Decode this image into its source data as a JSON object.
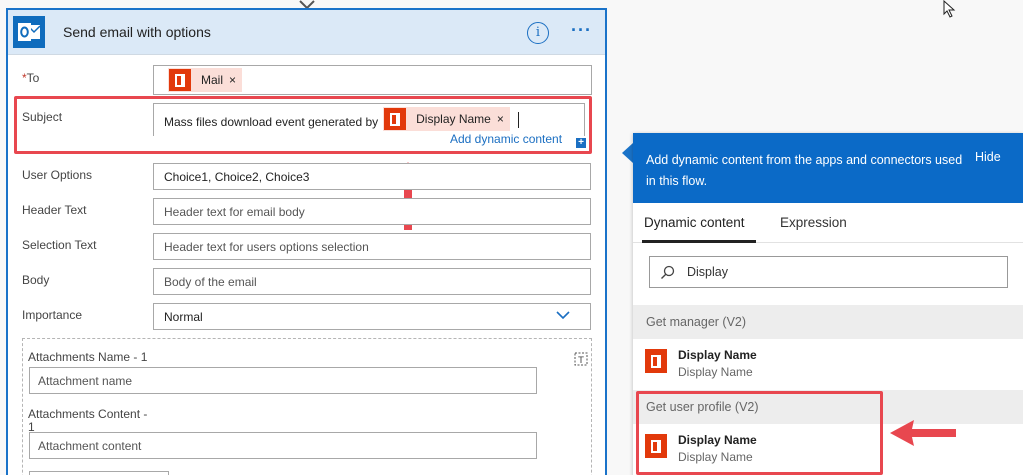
{
  "card": {
    "title": "Send email with options",
    "info_glyph": "i",
    "more_glyph": "···",
    "icons": {
      "app": "outlook-icon",
      "info": "info-icon",
      "more": "more-icon"
    }
  },
  "fields": {
    "to": {
      "label": "To",
      "required_mark": "*",
      "token": "Mail",
      "token_remove": "×"
    },
    "subject": {
      "label": "Subject",
      "text": "Mass files download event generated by",
      "token": "Display Name",
      "token_remove": "×"
    },
    "add_dynamic": {
      "label": "Add dynamic content",
      "plus": "+"
    },
    "user_options": {
      "label": "User Options",
      "value": "Choice1, Choice2, Choice3"
    },
    "header_text": {
      "label": "Header Text",
      "placeholder": "Header text for email body"
    },
    "selection_text": {
      "label": "Selection Text",
      "placeholder": "Header text for users options selection"
    },
    "body": {
      "label": "Body",
      "placeholder": "Body of the email"
    },
    "importance": {
      "label": "Importance",
      "value": "Normal"
    },
    "attachments": {
      "name_label": "Attachments Name - 1",
      "name_placeholder": "Attachment name",
      "content_label": "Attachments Content -",
      "content_label_wrap": "1",
      "content_placeholder": "Attachment content"
    }
  },
  "dynamic_panel": {
    "header": "Add dynamic content from the apps and connectors used in this flow.",
    "hide": "Hide",
    "tabs": [
      {
        "label": "Dynamic content",
        "active": true
      },
      {
        "label": "Expression",
        "active": false
      }
    ],
    "search_value": "Display",
    "groups": [
      {
        "title": "Get manager (V2)",
        "items": [
          {
            "name": "Display Name",
            "subtitle": "Display Name"
          }
        ]
      },
      {
        "title": "Get user profile (V2)",
        "items": [
          {
            "name": "Display Name",
            "subtitle": "Display Name"
          }
        ]
      }
    ]
  },
  "colors": {
    "accent": "#0b6ac7",
    "header_bg": "#dbe9f7",
    "highlight": "#e8474f",
    "office": "#e2390b",
    "token_bg": "#fbded8"
  }
}
